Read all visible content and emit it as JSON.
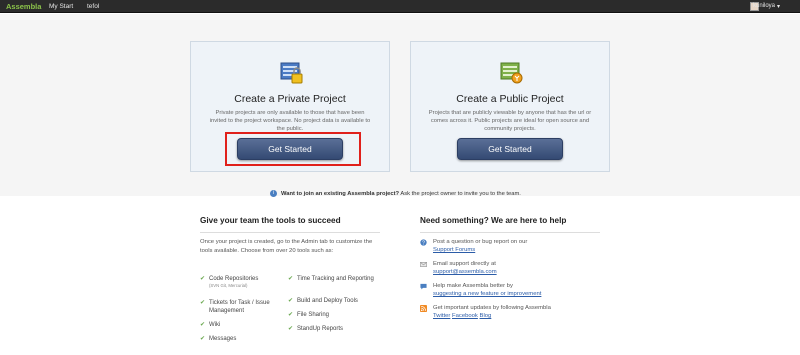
{
  "topbar": {
    "brand": "Assembla",
    "nav": [
      "My Start",
      "tefol"
    ],
    "username": "kuniloya",
    "caret": "▾"
  },
  "private_card": {
    "title": "Create a Private Project",
    "desc": "Private projects are only available to those that have been invited to the project workspace. No project data is available to the public.",
    "button": "Get Started",
    "icon": "private-project-lock-icon"
  },
  "public_card": {
    "title": "Create a Public Project",
    "desc": "Projects that are publicly viewable by anyone that has the url or comes across it. Public projects are ideal for open source and community projects.",
    "button": "Get Started",
    "icon": "public-project-icon"
  },
  "join": {
    "bold": "Want to join an existing Assembla project?",
    "rest": " Ask the project owner to invite you to the team."
  },
  "tools": {
    "title": "Give your team the tools to succeed",
    "intro": "Once your project is created, go to the Admin tab to customize the tools available. Choose from over 20 tools such as:",
    "col1": [
      {
        "label": "Code Repositories",
        "sub": "(SVN Git, Mercurial)"
      },
      {
        "label": "Tickets for Task / Issue Management",
        "sub": ""
      },
      {
        "label": "Wiki",
        "sub": ""
      },
      {
        "label": "Messages",
        "sub": ""
      }
    ],
    "col2": [
      {
        "label": "Time Tracking and Reporting",
        "sub": ""
      },
      {
        "label": "Build and Deploy Tools",
        "sub": ""
      },
      {
        "label": "File Sharing",
        "sub": ""
      },
      {
        "label": "StandUp Reports",
        "sub": ""
      }
    ]
  },
  "help": {
    "title": "Need something? We are here to help",
    "items": [
      {
        "text": "Post a question or bug report on our",
        "link": "Support Forums"
      },
      {
        "text": "Email support directly at",
        "link": "support@assembla.com"
      },
      {
        "text": "Help make Assembla better by",
        "link": "suggesting a new feature or improvement"
      },
      {
        "text": "Get important updates by following Assembla",
        "links": [
          "Twitter",
          "Facebook",
          "Blog"
        ]
      }
    ]
  },
  "colors": {
    "topbar": "#2b2b2b",
    "brand": "#8bc34a",
    "button": "#3f5580",
    "highlight": "#e0201b",
    "link": "#2b5ca8"
  }
}
